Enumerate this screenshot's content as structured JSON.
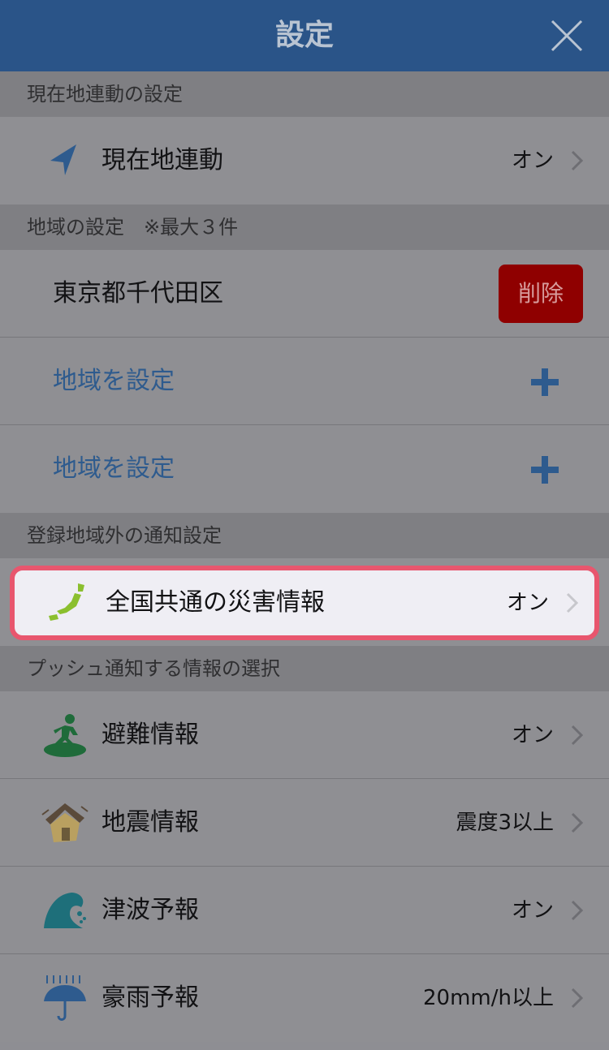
{
  "header": {
    "title": "設定",
    "close_icon": "close-icon"
  },
  "sections": {
    "location": {
      "title": "現在地連動の設定",
      "row": {
        "label": "現在地連動",
        "value": "オン",
        "icon": "location-arrow-icon"
      }
    },
    "regions": {
      "title": "地域の設定　※最大３件",
      "registered": {
        "label": "東京都千代田区",
        "delete_label": "削除"
      },
      "add_rows": [
        {
          "label": "地域を設定"
        },
        {
          "label": "地域を設定"
        }
      ]
    },
    "outside": {
      "title": "登録地域外の通知設定",
      "row": {
        "label": "全国共通の災害情報",
        "value": "オン",
        "icon": "japan-map-icon"
      }
    },
    "push": {
      "title": "プッシュ通知する情報の選択",
      "items": [
        {
          "label": "避難情報",
          "value": "オン",
          "icon": "evacuation-icon"
        },
        {
          "label": "地震情報",
          "value": "震度3以上",
          "icon": "earthquake-house-icon"
        },
        {
          "label": "津波予報",
          "value": "オン",
          "icon": "tsunami-wave-icon"
        },
        {
          "label": "豪雨予報",
          "value": "20mm/h以上",
          "icon": "rain-umbrella-icon"
        }
      ]
    }
  },
  "colors": {
    "navbar": "#2a5488",
    "accent_link": "#2e5b8e",
    "delete": "#8f0000",
    "highlight": "#e8566e"
  }
}
